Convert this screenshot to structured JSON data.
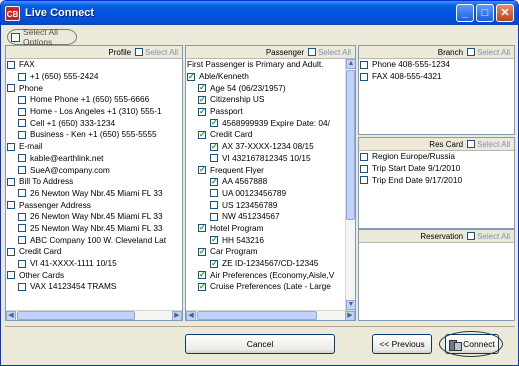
{
  "window": {
    "app_icon": "CB",
    "title": "Live Connect"
  },
  "title_buttons": {
    "minimize": "_",
    "maximize": "□",
    "close": "✕"
  },
  "select_all_options": "Select All Options",
  "profile": {
    "header": "Profile",
    "select_all": "Select All",
    "rows": [
      {
        "text": "FAX",
        "level": 0,
        "checked": false
      },
      {
        "text": "+1 (650) 555-2424",
        "level": 1,
        "checked": false
      },
      {
        "text": "Phone",
        "level": 0,
        "checked": false
      },
      {
        "text": "Home Phone +1 (650) 555-6666",
        "level": 1,
        "checked": false
      },
      {
        "text": "Home - Los Angeles +1 (310) 555-1",
        "level": 1,
        "checked": false
      },
      {
        "text": "Cell +1 (650) 333-1234",
        "level": 1,
        "checked": false
      },
      {
        "text": "Business - Ken +1 (650) 555-5555",
        "level": 1,
        "checked": false
      },
      {
        "text": "E-mail",
        "level": 0,
        "checked": false
      },
      {
        "text": "kable@earthlink.net",
        "level": 1,
        "checked": false
      },
      {
        "text": "SueA@company.com",
        "level": 1,
        "checked": false
      },
      {
        "text": "Bill To Address",
        "level": 0,
        "checked": false
      },
      {
        "text": "26 Newton Way Nbr.45 Miami FL 33",
        "level": 1,
        "checked": false
      },
      {
        "text": "Passenger Address",
        "level": 0,
        "checked": false
      },
      {
        "text": "26 Newton Way Nbr.45 Miami FL 33",
        "level": 1,
        "checked": false
      },
      {
        "text": "25 Newton Way Nbr.45 Miami FL 33",
        "level": 1,
        "checked": false
      },
      {
        "text": "ABC Company 100 W. Cleveland Lat",
        "level": 1,
        "checked": false
      },
      {
        "text": "Credit Card",
        "level": 0,
        "checked": false
      },
      {
        "text": "VI 41-XXXX-1111 10/15",
        "level": 1,
        "checked": false
      },
      {
        "text": "Other Cards",
        "level": 0,
        "checked": false
      },
      {
        "text": "VAX 14123454   TRAMS",
        "level": 1,
        "checked": false
      }
    ]
  },
  "passenger": {
    "header": "Passenger",
    "select_all": "Select All",
    "note": "First Passenger is Primary and Adult.",
    "rows": [
      {
        "text": "Able/Kenneth",
        "level": 0,
        "checked": true
      },
      {
        "text": "Age 54 (06/23/1957)",
        "level": 1,
        "checked": true
      },
      {
        "text": "Citizenship US",
        "level": 1,
        "checked": true
      },
      {
        "text": "Passport",
        "level": 1,
        "checked": true
      },
      {
        "text": "4568999939 Expire Date: 04/",
        "level": 2,
        "checked": true
      },
      {
        "text": "Credit Card",
        "level": 1,
        "checked": true
      },
      {
        "text": "AX 37-XXXX-1234 08/15",
        "level": 2,
        "checked": true
      },
      {
        "text": "VI 432167812345 10/15",
        "level": 2,
        "checked": false
      },
      {
        "text": "Frequent Flyer",
        "level": 1,
        "checked": true
      },
      {
        "text": "AA 4567888",
        "level": 2,
        "checked": true
      },
      {
        "text": "UA 00123456789",
        "level": 2,
        "checked": false
      },
      {
        "text": "US 123456789",
        "level": 2,
        "checked": false
      },
      {
        "text": "NW 451234567",
        "level": 2,
        "checked": false
      },
      {
        "text": "Hotel Program",
        "level": 1,
        "checked": true
      },
      {
        "text": "HH 543216",
        "level": 2,
        "checked": true
      },
      {
        "text": "Car Program",
        "level": 1,
        "checked": true
      },
      {
        "text": "ZE ID-1234567/CD-12345",
        "level": 2,
        "checked": true
      },
      {
        "text": "Air Preferences (Economy,Aisle,V",
        "level": 1,
        "checked": true
      },
      {
        "text": "Cruise Preferences (Late - Large",
        "level": 1,
        "checked": true
      }
    ]
  },
  "branch": {
    "header": "Branch",
    "select_all": "Select All",
    "rows": [
      {
        "text": "Phone 408-555-1234",
        "level": 0,
        "checked": false
      },
      {
        "text": "FAX 408-555-4321",
        "level": 0,
        "checked": false
      }
    ]
  },
  "res_card": {
    "header": "Res Card",
    "select_all": "Select All",
    "rows": [
      {
        "text": "Region Europe/Russia",
        "level": 0,
        "checked": false
      },
      {
        "text": "Trip Start Date 9/1/2010",
        "level": 0,
        "checked": false
      },
      {
        "text": "Trip End Date 9/17/2010",
        "level": 0,
        "checked": false
      }
    ]
  },
  "reservation": {
    "header": "Reservation",
    "select_all": "Select All"
  },
  "buttons": {
    "cancel": "Cancel",
    "previous": "<< Previous",
    "connect": "Connect"
  },
  "scroll_arrows": {
    "up": "▲",
    "down": "▼",
    "left": "◀",
    "right": "▶"
  }
}
